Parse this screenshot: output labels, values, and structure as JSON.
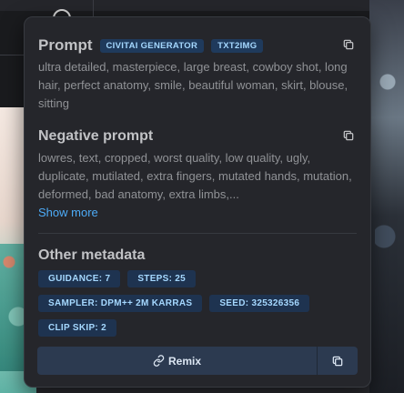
{
  "prompt": {
    "title": "Prompt",
    "badges": [
      "CIVITAI GENERATOR",
      "TXT2IMG"
    ],
    "text": "ultra detailed, masterpiece, large breast, cowboy shot, long hair, perfect anatomy, smile, beautiful woman, skirt, blouse, sitting"
  },
  "negative_prompt": {
    "title": "Negative prompt",
    "text": "lowres, text, cropped, worst quality, low quality, ugly, duplicate, mutilated, extra fingers, mutated hands, mutation, deformed, bad anatomy, extra limbs,...",
    "show_more": "Show more"
  },
  "other_metadata": {
    "title": "Other metadata",
    "chips": [
      "GUIDANCE: 7",
      "STEPS: 25",
      "SAMPLER: DPM++ 2M KARRAS",
      "SEED: 325326356",
      "CLIP SKIP: 2"
    ]
  },
  "actions": {
    "remix_label": "Remix"
  },
  "icons": {
    "copy": "copy-icon",
    "link": "link-icon"
  },
  "colors": {
    "background": "#25262b",
    "badge_bg": "#1f3a5c",
    "badge_text": "#a5d8ff",
    "link": "#4dabf7"
  }
}
